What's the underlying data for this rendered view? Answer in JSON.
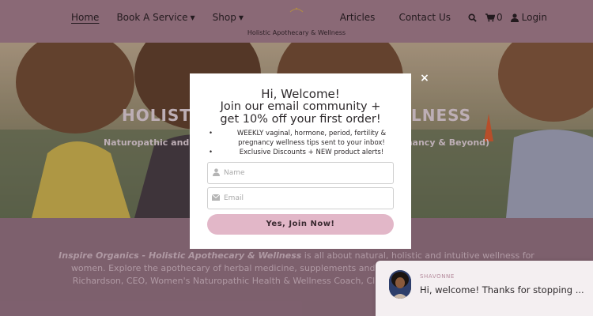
{
  "header": {
    "nav_left": [
      {
        "label": "Home",
        "active": true
      },
      {
        "label": "Book A Service",
        "caret": true
      },
      {
        "label": "Shop",
        "caret": true
      }
    ],
    "nav_right": {
      "articles": "Articles",
      "contact": "Contact Us",
      "cart_count": "0",
      "login": "Login"
    },
    "tagline": "Holistic Apothecary & Wellness"
  },
  "hero": {
    "title": "HOLISTIC APOTHECARY & WELLNESS",
    "subtitle": "Naturopathic and Holistic Wellness for Women (Fertility, Pregnancy & Beyond)"
  },
  "about": {
    "brand": "Inspire Organics - Holistic Apothecary & Wellness",
    "text_1": " is all about natural, holistic and intuitive wellness for women. Explore the apothecary of herbal medicine, supplements and ",
    "text_2": "wellbeing. Founded by Shavonne Richardson, CEO, Women's Naturopathic ",
    "text_3": "Health & Wellness Coach, Clinical Herbalist, Nutritionist and F"
  },
  "modal": {
    "title_line1": "Hi, Welcome!",
    "title_line2": "Join our email community +",
    "title_line3": "get 10% off your first order!",
    "bullets": [
      "WEEKLY vaginal, hormone, period, fertility & pregnancy wellness tips sent to your inbox!",
      "Exclusive Discounts + NEW product alerts!"
    ],
    "name_placeholder": "Name",
    "email_placeholder": "Email",
    "submit_label": "Yes, Join Now!",
    "close_label": "×"
  },
  "chat": {
    "agent_name": "SHAVONNE",
    "message": "Hi, welcome! Thanks for stopping ..."
  },
  "colors": {
    "header_bg": "#9c7b87",
    "button_pink": "#e2b7c8",
    "page_bg": "#8c6f7c"
  }
}
